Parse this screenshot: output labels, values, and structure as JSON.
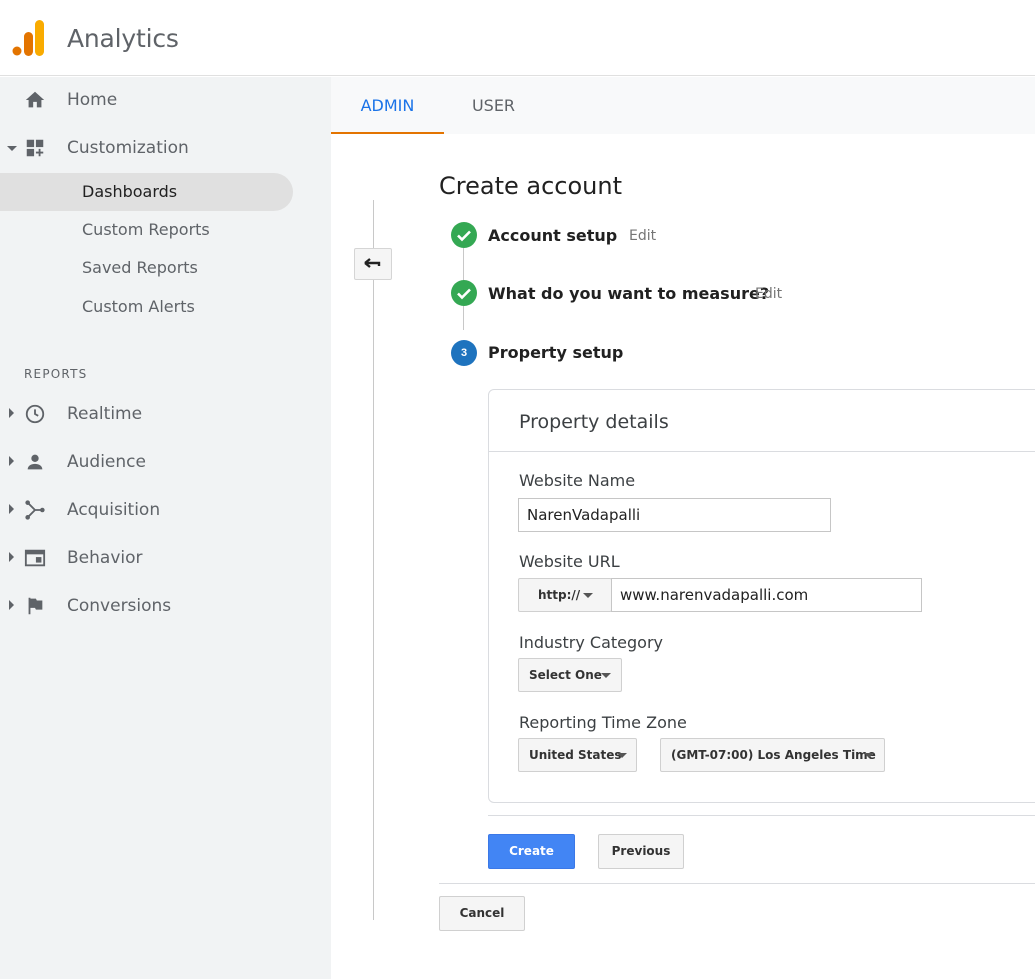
{
  "app": {
    "title": "Analytics",
    "colors": {
      "logo_orange": "#F9AB00",
      "logo_dark": "#E37400",
      "accent": "#1a73e8",
      "success": "#34a853",
      "step_blue": "#1e73be",
      "primary_button": "#4285f4"
    }
  },
  "sidebar": {
    "items": [
      {
        "label": "Home",
        "icon": "home-icon"
      },
      {
        "label": "Customization",
        "icon": "dashboard-grid-icon"
      }
    ],
    "customization_sub": [
      {
        "label": "Dashboards",
        "active": true
      },
      {
        "label": "Custom Reports"
      },
      {
        "label": "Saved Reports"
      },
      {
        "label": "Custom Alerts"
      }
    ],
    "reports_section": "REPORTS",
    "reports": [
      {
        "label": "Realtime",
        "icon": "clock-icon"
      },
      {
        "label": "Audience",
        "icon": "person-icon"
      },
      {
        "label": "Acquisition",
        "icon": "acquisition-icon"
      },
      {
        "label": "Behavior",
        "icon": "behavior-icon"
      },
      {
        "label": "Conversions",
        "icon": "flag-icon"
      }
    ]
  },
  "tabs": [
    {
      "label": "ADMIN",
      "active": true
    },
    {
      "label": "USER"
    }
  ],
  "main": {
    "title": "Create account",
    "steps": [
      {
        "label": "Account setup",
        "edit": "Edit",
        "status": "done"
      },
      {
        "label": "What do you want to measure?",
        "edit": "Edit",
        "status": "done"
      },
      {
        "label": "Property setup",
        "number": "3",
        "status": "current"
      }
    ],
    "card": {
      "title": "Property details",
      "website_name": {
        "label": "Website Name",
        "value": "NarenVadapalli"
      },
      "website_url": {
        "label": "Website URL",
        "protocol": "http://",
        "value": "www.narenvadapalli.com"
      },
      "industry": {
        "label": "Industry Category",
        "value": "Select One"
      },
      "timezone": {
        "label": "Reporting Time Zone",
        "country": "United States",
        "zone": "(GMT-07:00) Los Angeles Time"
      }
    },
    "buttons": {
      "create": "Create",
      "previous": "Previous",
      "cancel": "Cancel"
    }
  }
}
